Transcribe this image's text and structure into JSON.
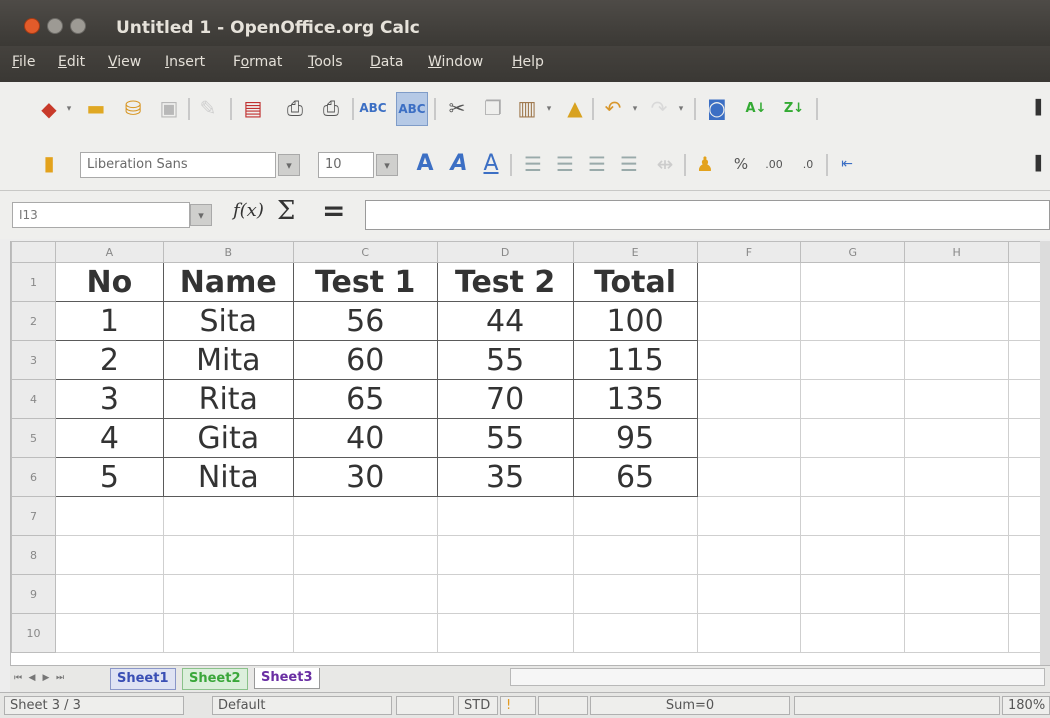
{
  "window": {
    "title": "Untitled 1 - OpenOffice.org Calc"
  },
  "menu": [
    {
      "label": "File",
      "key": "F"
    },
    {
      "label": "Edit",
      "key": "E"
    },
    {
      "label": "View",
      "key": "V"
    },
    {
      "label": "Insert",
      "key": "I"
    },
    {
      "label": "Format",
      "key": "o"
    },
    {
      "label": "Tools",
      "key": "T"
    },
    {
      "label": "Data",
      "key": "D"
    },
    {
      "label": "Window",
      "key": "W"
    },
    {
      "label": "Help",
      "key": "H"
    }
  ],
  "formatting": {
    "font_name": "Liberation Sans",
    "font_size": "10"
  },
  "formula_bar": {
    "cell_ref": "I13",
    "fx_label": "f(x)",
    "sum_symbol": "Σ",
    "equals_symbol": "=",
    "content": ""
  },
  "grid": {
    "columns": [
      "A",
      "B",
      "C",
      "D",
      "E",
      "F",
      "G",
      "H"
    ],
    "rows": [
      "1",
      "2",
      "3",
      "4",
      "5",
      "6",
      "7",
      "8",
      "9",
      "10"
    ],
    "cells": [
      [
        "No",
        "Name",
        "Test 1",
        "Test 2",
        "Total"
      ],
      [
        "1",
        "Sita",
        "56",
        "44",
        "100"
      ],
      [
        "2",
        "Mita",
        "60",
        "55",
        "115"
      ],
      [
        "3",
        "Rita",
        "65",
        "70",
        "135"
      ],
      [
        "4",
        "Gita",
        "40",
        "55",
        "95"
      ],
      [
        "5",
        "Nita",
        "30",
        "35",
        "65"
      ]
    ]
  },
  "sheet_tabs": [
    {
      "label": "Sheet1",
      "color": "#3a4fb5"
    },
    {
      "label": "Sheet2",
      "color": "#3aa73a"
    },
    {
      "label": "Sheet3",
      "color": "#6a2fa3"
    }
  ],
  "status": {
    "sheet": "Sheet 3 / 3",
    "style": "Default",
    "mode": "STD",
    "sum": "Sum=0",
    "zoom": "180%"
  }
}
